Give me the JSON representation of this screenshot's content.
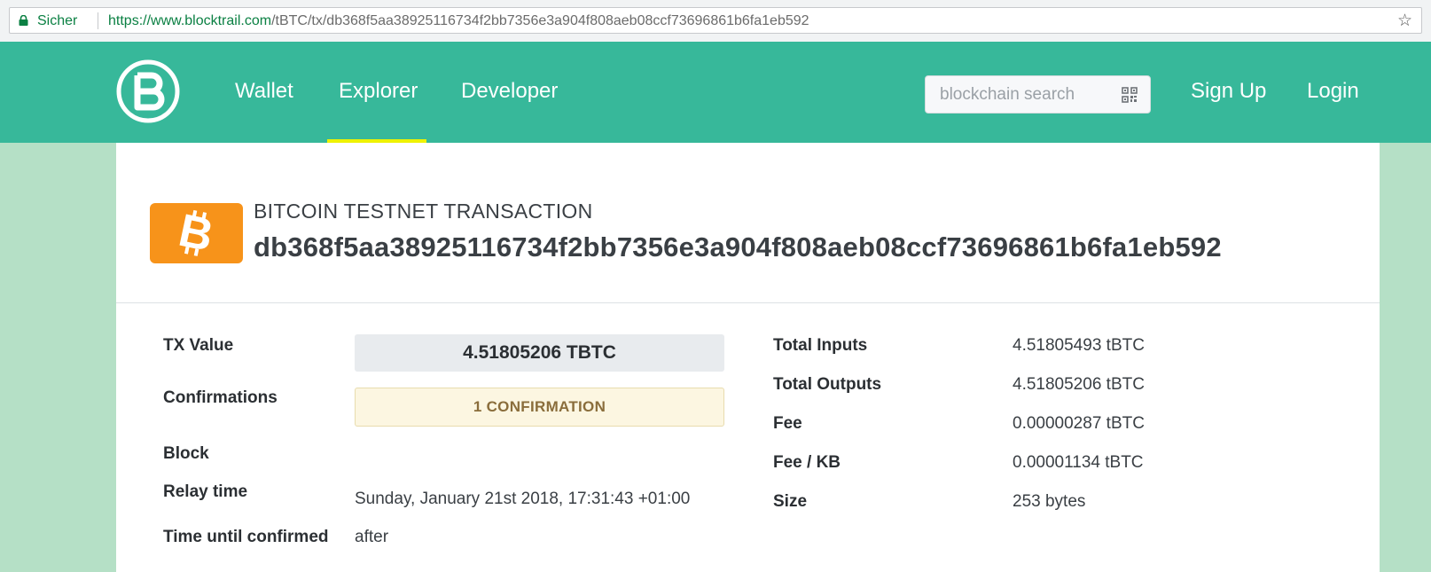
{
  "browser": {
    "secure_label": "Sicher",
    "url_prefix": "https://",
    "url_host": "www.blocktrail.com",
    "url_path": "/tBTC/tx/db368f5aa38925116734f2bb7356e3a904f808aeb08ccf73696861b6fa1eb592"
  },
  "nav": {
    "items": [
      {
        "label": "Wallet"
      },
      {
        "label": "Explorer"
      },
      {
        "label": "Developer"
      }
    ],
    "active": "Explorer",
    "search_placeholder": "blockchain search",
    "signup_label": "Sign Up",
    "login_label": "Login"
  },
  "colors": {
    "header": "#37b89a",
    "page_bg": "#b5e0c6",
    "active_underline": "#eef200",
    "bitcoin": "#f7931a"
  },
  "icons": {
    "lock": "lock-icon",
    "star": "star-icon",
    "logo": "blocktrail-logo",
    "qr": "qr-code-icon",
    "bitcoin": "bitcoin-icon"
  },
  "tx": {
    "kicker": "BITCOIN TESTNET TRANSACTION",
    "hash": "db368f5aa38925116734f2bb7356e3a904f808aeb08ccf73696861b6fa1eb592"
  },
  "details_left": {
    "tx_value_label": "TX Value",
    "tx_value": "4.51805206 TBTC",
    "confirmations_label": "Confirmations",
    "confirmations": "1 CONFIRMATION",
    "block_label": "Block",
    "relay_time_label": "Relay time",
    "relay_time": "Sunday, January 21st 2018, 17:31:43 +01:00",
    "time_until_confirmed_label": "Time until confirmed",
    "time_until_confirmed": "after"
  },
  "details_right": [
    {
      "label": "Total Inputs",
      "value": "4.51805493 tBTC"
    },
    {
      "label": "Total Outputs",
      "value": "4.51805206 tBTC"
    },
    {
      "label": "Fee",
      "value": "0.00000287 tBTC"
    },
    {
      "label": "Fee / KB",
      "value": "0.00001134 tBTC"
    },
    {
      "label": "Size",
      "value": "253 bytes"
    }
  ]
}
